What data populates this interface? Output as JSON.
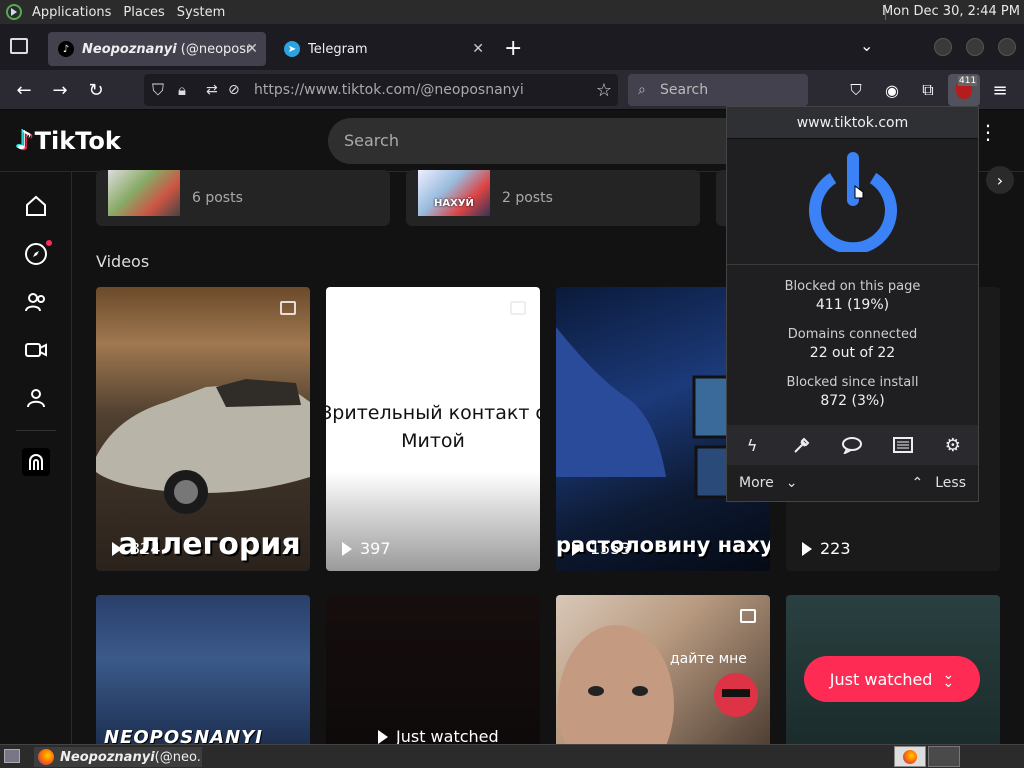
{
  "top_panel": {
    "menus": [
      "Applications",
      "Places",
      "System"
    ],
    "clock": "Mon Dec 30,  2:44 PM"
  },
  "tabs": [
    {
      "title_bold": "Neopoznanyi",
      "title_rest": " (@neoposnan"
    },
    {
      "title_bold": "",
      "title_rest": "Telegram"
    }
  ],
  "navbar": {
    "url_host": "https://www.tiktok.com",
    "url_path": "/@neoposnanyi",
    "search_placeholder": "Search",
    "ublock_badge": "411"
  },
  "tiktok": {
    "logo": "TikTok",
    "search_placeholder": "Search",
    "playlists": [
      {
        "label": "6 posts",
        "thumb_text": ""
      },
      {
        "label": "2 posts",
        "thumb_text": "НАХУЙ"
      }
    ],
    "section_title": "Videos",
    "videos_row1": [
      {
        "views": "324",
        "overlay": "аллегория"
      },
      {
        "views": "397",
        "overlay": "Зрительный контакт с Митой"
      },
      {
        "views": "1553",
        "overlay": "растоловину нахуй"
      },
      {
        "views": "223",
        "overlay": ""
      }
    ],
    "videos_row2": [
      {
        "overlay": "NEOPOSNANYI"
      },
      {
        "overlay": "Just watched"
      },
      {
        "overlay": "дайте мне"
      },
      {
        "overlay": ""
      }
    ],
    "just_watched_button": "Just watched"
  },
  "ublock": {
    "domain": "www.tiktok.com",
    "blocked_page_label": "Blocked on this page",
    "blocked_page_value": "411 (19%)",
    "domains_label": "Domains connected",
    "domains_value": "22 out of 22",
    "since_label": "Blocked since install",
    "since_value": "872 (3%)",
    "more_label": "More",
    "less_label": "Less"
  },
  "taskbar": {
    "item_bold": "Neopoznanyi",
    "item_rest": " (@neo..."
  },
  "colors": {
    "tiktok_red": "#fe2c55",
    "ublock_blue": "#3b82f6",
    "ublock_red": "#b71c1c"
  }
}
